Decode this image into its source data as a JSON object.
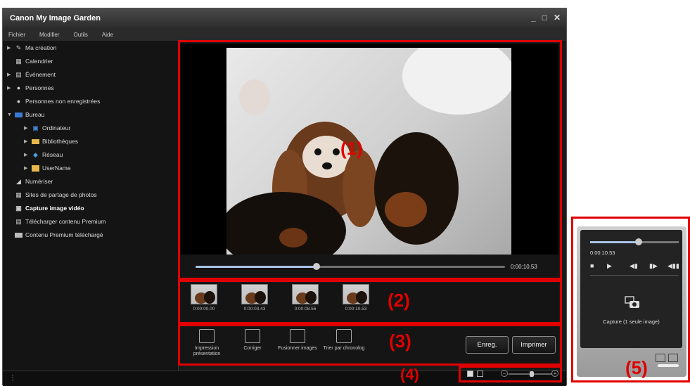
{
  "window": {
    "title": "Canon My Image Garden"
  },
  "window_controls": {
    "minimize": "_",
    "maximize": "□",
    "close": "✕"
  },
  "menu": [
    "Fichier",
    "Modifier",
    "Outils",
    "Aide"
  ],
  "tree": [
    {
      "label": "Ma création",
      "icon": "edit-icon",
      "expandable": true
    },
    {
      "label": "Calendrier",
      "icon": "calendar-icon",
      "expandable": false
    },
    {
      "label": "Événement",
      "icon": "event-icon",
      "expandable": true
    },
    {
      "label": "Personnes",
      "icon": "person-icon",
      "expandable": true
    },
    {
      "label": "Personnes non enregistrées",
      "icon": "person-icon",
      "expandable": false
    },
    {
      "label": "Bureau",
      "icon": "desktop-icon",
      "expanded": true
    },
    {
      "label": "Ordinateur",
      "icon": "computer-icon",
      "expandable": true
    },
    {
      "label": "Bibliothèques",
      "icon": "folder-icon",
      "expandable": true
    },
    {
      "label": "Réseau",
      "icon": "network-icon",
      "expandable": true
    },
    {
      "label": "UserName",
      "icon": "user-folder-icon",
      "expandable": true
    },
    {
      "label": "Numériser",
      "icon": "scan-icon",
      "expandable": false
    },
    {
      "label": "Sites de partage de photos",
      "icon": "share-icon",
      "expandable": false
    },
    {
      "label": "Capture image vidéo",
      "icon": "video-capture-icon",
      "selected": true
    },
    {
      "label": "Télécharger contenu Premium",
      "icon": "download-icon",
      "expandable": false
    },
    {
      "label": "Contenu Premium téléchargé",
      "icon": "folder-icon",
      "expandable": false
    }
  ],
  "playback": {
    "current_time": "0:00:10.53",
    "progress": 0.39
  },
  "thumbnails": [
    "0:00:00.00",
    "0:00:03.43",
    "0:00:08.56",
    "0:00:10.53"
  ],
  "actions": [
    {
      "label": "Impression présentation",
      "icon": "print-layout-icon"
    },
    {
      "label": "Corriger",
      "icon": "correct-icon"
    },
    {
      "label": "Fusionner images",
      "icon": "merge-icon"
    },
    {
      "label": "Trier par chronolog",
      "icon": "sort-time-icon"
    }
  ],
  "buttons": {
    "save": "Enreg.",
    "print": "Imprimer"
  },
  "callouts": [
    "(1)",
    "(2)",
    "(3)",
    "(4)",
    "(5)"
  ],
  "panel5": {
    "time": "0:00:10.53",
    "progress": 0.55,
    "controls": [
      "■",
      "▶",
      "◀▮",
      "▮▶",
      "◀▮▮"
    ],
    "capture_label": "Capture (1 seule image)"
  },
  "colors": {
    "highlight": "#e00000",
    "progress": "#a8c4e8"
  }
}
